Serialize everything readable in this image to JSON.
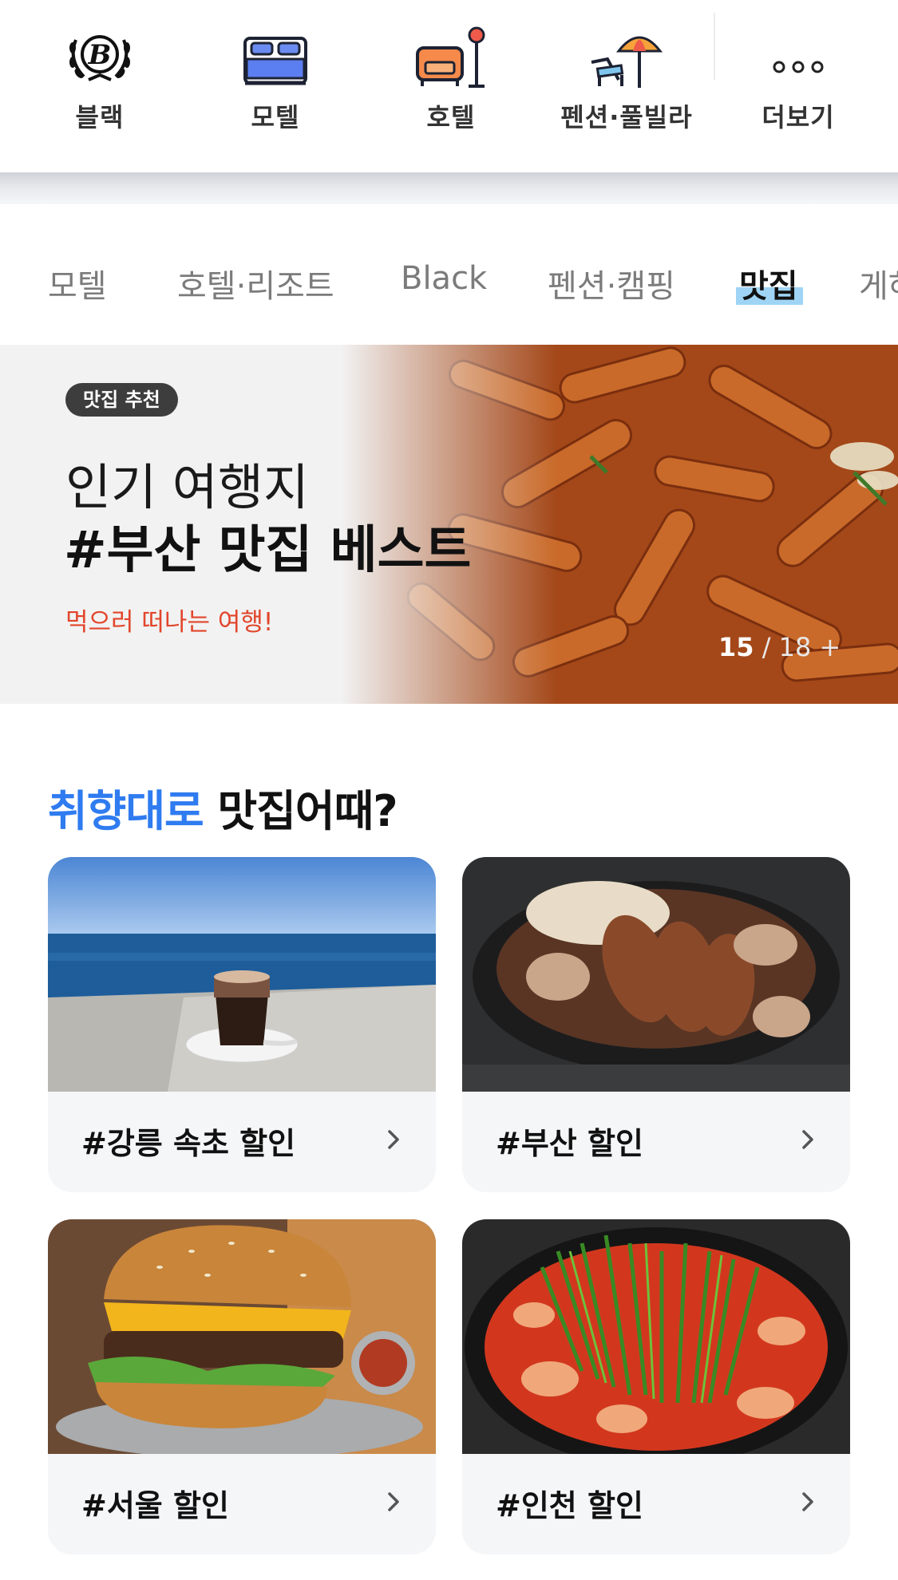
{
  "categories": [
    {
      "label": "블랙",
      "icon": "black-laurel-icon"
    },
    {
      "label": "모텔",
      "icon": "bed-icon"
    },
    {
      "label": "호텔",
      "icon": "sofa-lamp-icon"
    },
    {
      "label": "펜션·풀빌라",
      "icon": "beach-umbrella-icon"
    },
    {
      "label": "더보기",
      "icon": "more-dots-icon"
    }
  ],
  "tabs": [
    {
      "label": "모텔",
      "active": false
    },
    {
      "label": "호텔·리조트",
      "active": false
    },
    {
      "label": "Black",
      "active": false
    },
    {
      "label": "펜션·캠핑",
      "active": false
    },
    {
      "label": "맛집",
      "active": true
    },
    {
      "label": "게하",
      "active": false
    }
  ],
  "banner": {
    "badge": "맛집 추천",
    "line1": "인기 여행지",
    "line2": "#부산 맛집 베스트",
    "subtitle": "먹으러 떠나는 여행!",
    "pager_current": "15",
    "pager_sep": " / ",
    "pager_total": "18",
    "pager_more": "+"
  },
  "section": {
    "title_highlight": "취향대로",
    "title_rest": " 맛집어때?"
  },
  "cards": [
    {
      "label": "#강릉 속초 할인",
      "image": "coffee-seaside-photo"
    },
    {
      "label": "#부산 할인",
      "image": "jokbal-photo"
    },
    {
      "label": "#서울 할인",
      "image": "burger-photo"
    },
    {
      "label": "#인천 할인",
      "image": "spicy-stew-photo"
    }
  ],
  "colors": {
    "accent_blue": "#2f7bf0",
    "banner_sub_red": "#e2452b",
    "tab_highlight": "#9fd4f5"
  }
}
